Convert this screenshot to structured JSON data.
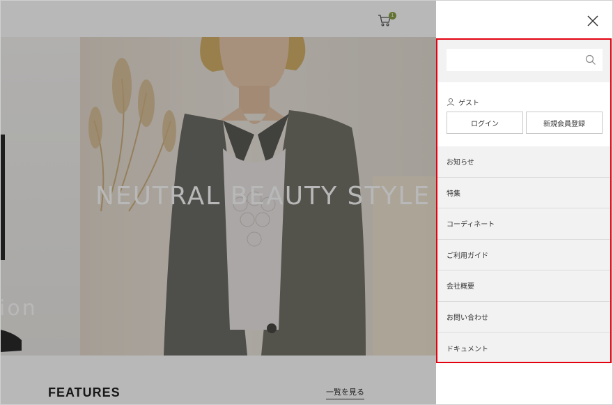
{
  "header": {
    "cart_count": "1"
  },
  "hero": {
    "caption": "NEUTRAL BEAUTY STYLE",
    "side_text": "ion"
  },
  "section": {
    "title": "FEATURES",
    "view_all": "一覧を見る"
  },
  "drawer": {
    "search_placeholder": "",
    "user_label": "ゲスト",
    "login_label": "ログイン",
    "register_label": "新規会員登録",
    "menu_items": [
      {
        "label": "お知らせ"
      },
      {
        "label": "特集"
      },
      {
        "label": "コーディネート"
      },
      {
        "label": "ご利用ガイド"
      },
      {
        "label": "会社概要"
      },
      {
        "label": "お問い合わせ"
      },
      {
        "label": "ドキュメント"
      }
    ]
  },
  "colors": {
    "highlight_border": "#e3000f",
    "cart_badge": "#8aa045",
    "overlay": "rgba(0,0,0,0.28)"
  }
}
